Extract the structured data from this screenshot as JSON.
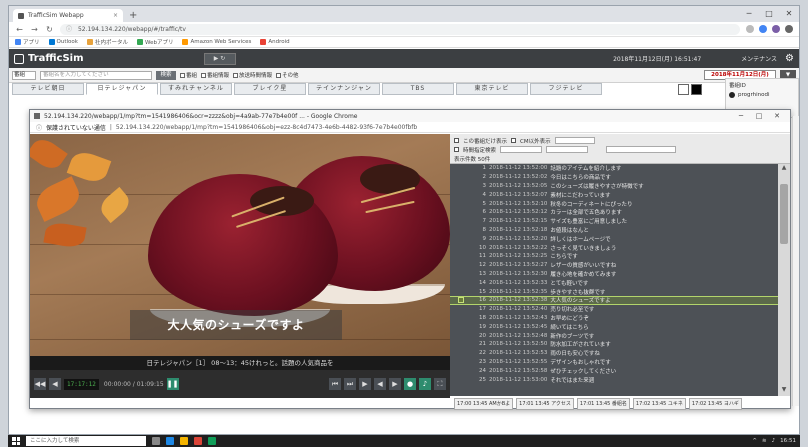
{
  "browser": {
    "tab_title": "TrafficSim Webapp",
    "back_icon": "back-arrow-icon",
    "url": "52.194.134.220/webapp/#/traffic/tv",
    "bookmarks": [
      "アプリ",
      "Outlook",
      "社内ポータル",
      "Webアプリ",
      "Amazon Web Services",
      "Android"
    ]
  },
  "app": {
    "brand": "TrafficSim",
    "datetime": "2018年11月12日(月) 16:51:47",
    "maintenance": "メンテナンス",
    "filter": {
      "select_value": "番組",
      "search_placeholder": "番組名を入力してください",
      "search_button": "検索",
      "checks": [
        "番組",
        "番組情報",
        "放送時間情報",
        "その他"
      ],
      "date": "2018年11月12日(月)",
      "date_btn": "▼"
    },
    "channel_tabs": [
      "テレビ朝日",
      "日テレジャパン",
      "すみれチャンネル",
      "ブレイク星",
      "テインナンジャン",
      "TBS",
      "東京テレビ",
      "フジテレビ"
    ],
    "top_right": {
      "label": "番組ID",
      "value": "progrhinodi"
    }
  },
  "popup": {
    "title": "52.194.134.220/webapp/1/mp?tm=1541986406&ocr=zzzz&obj=4a9ab-77e7b4e00f ... - Google Chrome",
    "url_prefix": "保護されていない通信",
    "url": "52.194.134.220/webapp/1/mp?tm=1541986406&obj=ezz-8c4d7473-4e6b-4482-93f6-7e7b4e00fbfb",
    "video": {
      "subtitle": "大人気のシューズですよ",
      "caption": "日テレジャパン［1］ 08～13：45けれっと。話題の人気商品を",
      "timecode": "17:17:12",
      "time_range": "00:00:00 / 01:09:15"
    },
    "panel": {
      "head_row1": [
        "この番組だけ表示",
        "CM以外表示",
        "2018-11-12"
      ],
      "head_row2": [
        "時間指定検索",
        "2018-11-12",
        "23:59",
        "キーワード"
      ],
      "head_row3": "表示件数 50件",
      "log": [
        {
          "n": "1",
          "ts": "2018-11-12 13:52:00",
          "text": "話題のアイテムを紹介します"
        },
        {
          "n": "2",
          "ts": "2018-11-12 13:52:02",
          "text": "今日はこちらの商品です"
        },
        {
          "n": "3",
          "ts": "2018-11-12 13:52:05",
          "text": "このシューズは履きやすさが特徴です"
        },
        {
          "n": "4",
          "ts": "2018-11-12 13:52:07",
          "text": "素材にこだわっています"
        },
        {
          "n": "5",
          "ts": "2018-11-12 13:52:10",
          "text": "秋冬のコーディネートにぴったり"
        },
        {
          "n": "6",
          "ts": "2018-11-12 13:52:12",
          "text": "カラーは全部で五色あります"
        },
        {
          "n": "7",
          "ts": "2018-11-12 13:52:15",
          "text": "サイズも豊富にご用意しました"
        },
        {
          "n": "8",
          "ts": "2018-11-12 13:52:18",
          "text": "お値段はなんと"
        },
        {
          "n": "9",
          "ts": "2018-11-12 13:52:20",
          "text": "詳しくはホームページで"
        },
        {
          "n": "10",
          "ts": "2018-11-12 13:52:22",
          "text": "さっそく見ていきましょう"
        },
        {
          "n": "11",
          "ts": "2018-11-12 13:52:25",
          "text": "こちらです"
        },
        {
          "n": "12",
          "ts": "2018-11-12 13:52:27",
          "text": "レザーの質感がいいですね"
        },
        {
          "n": "13",
          "ts": "2018-11-12 13:52:30",
          "text": "履き心地を確かめてみます"
        },
        {
          "n": "14",
          "ts": "2018-11-12 13:52:33",
          "text": "とても軽いです"
        },
        {
          "n": "15",
          "ts": "2018-11-12 13:52:35",
          "text": "歩きやすさも抜群です"
        },
        {
          "n": "16",
          "ts": "2018-11-12 13:52:38",
          "text": "大人気のシューズですよ"
        },
        {
          "n": "17",
          "ts": "2018-11-12 13:52:40",
          "text": "売り切れ必至です"
        },
        {
          "n": "18",
          "ts": "2018-11-12 13:52:43",
          "text": "お早めにどうぞ"
        },
        {
          "n": "19",
          "ts": "2018-11-12 13:52:45",
          "text": "続いてはこちら"
        },
        {
          "n": "20",
          "ts": "2018-11-12 13:52:48",
          "text": "新作のブーツです"
        },
        {
          "n": "21",
          "ts": "2018-11-12 13:52:50",
          "text": "防水加工がされています"
        },
        {
          "n": "22",
          "ts": "2018-11-12 13:52:53",
          "text": "雨の日も安心ですね"
        },
        {
          "n": "23",
          "ts": "2018-11-12 13:52:55",
          "text": "デザインもおしゃれです"
        },
        {
          "n": "24",
          "ts": "2018-11-12 13:52:58",
          "text": "ぜひチェックしてください"
        },
        {
          "n": "25",
          "ts": "2018-11-12 13:53:00",
          "text": "それではまた来週"
        }
      ],
      "highlight_index": 15
    },
    "bottom_boxes": [
      "17:00 13:45 AMかBよ",
      "17:01 13:45 アクセス",
      "17:01 13:45 番組名",
      "17:02 13:45 ユキネ",
      "17:02 13:45 ヨハギ"
    ]
  },
  "taskbar": {
    "search_placeholder": "ここに入力して検索",
    "clock": "16:51"
  }
}
